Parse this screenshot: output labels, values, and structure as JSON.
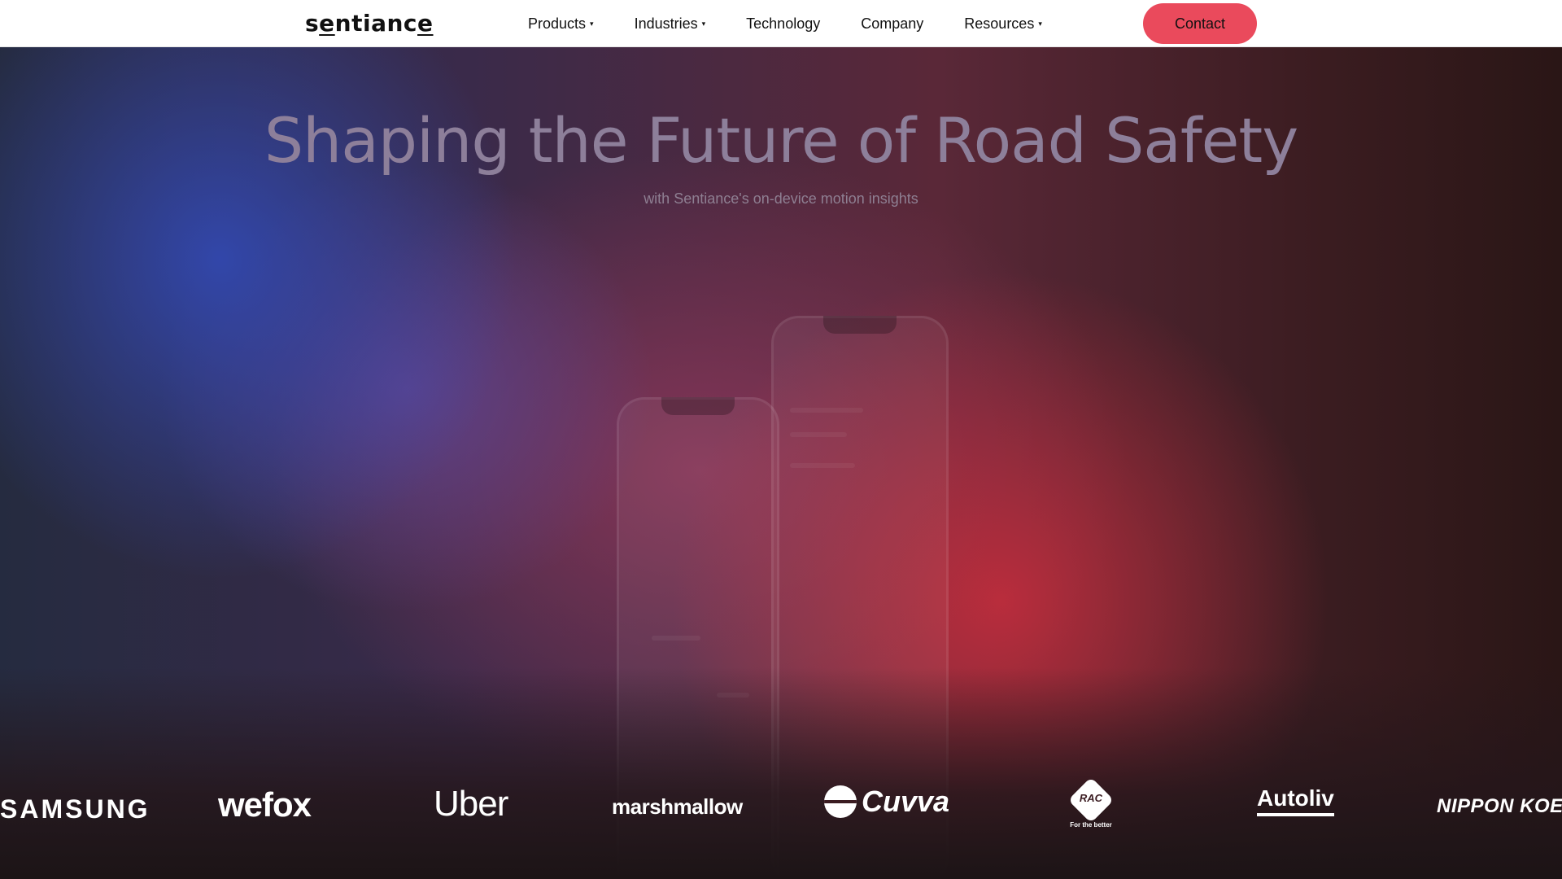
{
  "nav": {
    "logo": "sentiance",
    "items": [
      {
        "label": "Products",
        "has_dropdown": true
      },
      {
        "label": "Industries",
        "has_dropdown": true
      },
      {
        "label": "Technology",
        "has_dropdown": false
      },
      {
        "label": "Company",
        "has_dropdown": false
      },
      {
        "label": "Resources",
        "has_dropdown": true
      }
    ],
    "dropdown_glyph": "▾",
    "contact_label": "Contact"
  },
  "hero": {
    "title": "Shaping the Future of Road Safety",
    "subtitle": "with Sentiance's on-device motion insights"
  },
  "partners": [
    "SAMSUNG",
    "wefox",
    "Uber",
    "marshmallow",
    "Cuvva",
    "RAC",
    "Autoliv",
    "NIPPON KOEI"
  ],
  "rac_tagline": "For the better",
  "colors": {
    "accent": "#ea4a5c",
    "nav_bg": "#ffffff",
    "hero_blue": "#3248af",
    "hero_red": "#be2d3c"
  }
}
